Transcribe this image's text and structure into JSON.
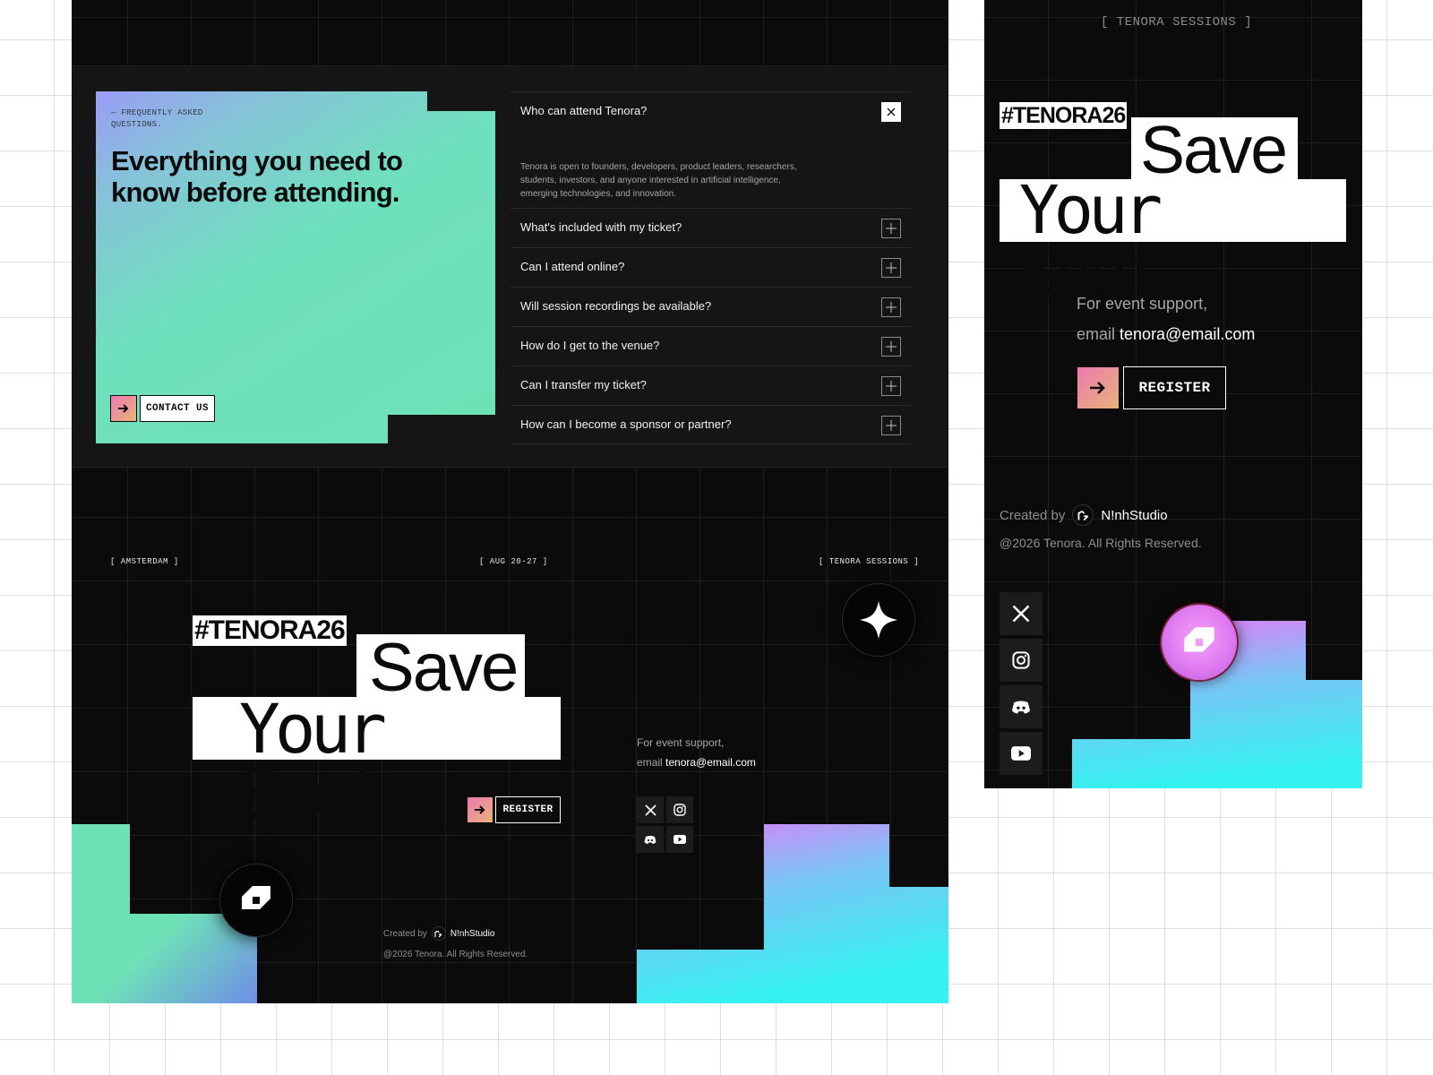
{
  "faq": {
    "kicker": "— FREQUENTLY ASKED QUESTIONS.",
    "title": "Everything you need to know before attending.",
    "contact_label": "CONTACT US",
    "items": [
      {
        "question": "Who can attend Tenora?",
        "answer": "Tenora is open to founders, developers, product leaders, researchers, students, investors, and anyone interested in artificial intelligence, emerging technologies, and innovation.",
        "open": true
      },
      {
        "question": "What's included with my ticket?",
        "open": false
      },
      {
        "question": "Can I attend online?",
        "open": false
      },
      {
        "question": "Will session recordings be available?",
        "open": false
      },
      {
        "question": "How do I get to the venue?",
        "open": false
      },
      {
        "question": "Can I transfer my ticket?",
        "open": false
      },
      {
        "question": "How can I become a sponsor or partner?",
        "open": false
      }
    ]
  },
  "hero": {
    "tag_location": "[ AMSTERDAM ]",
    "tag_dates": "[ AUG 20-27 ]",
    "tag_sessions": "[ TENORA SESSIONS ]",
    "hashtag": "#TENORA26",
    "headline_line1": "Save",
    "headline_line2": "Your Spot.",
    "register_label": "REGISTER",
    "support_line1": "For event support,",
    "support_prefix": "email",
    "support_email": "tenora@email.com"
  },
  "footer": {
    "created_by": "Created by",
    "studio": "N!nhStudio",
    "copyright": "@2026 Tenora. All Rights Reserved.",
    "social": [
      "x-icon",
      "instagram-icon",
      "discord-icon",
      "youtube-icon"
    ]
  },
  "mobile": {
    "tag_sessions": "[ TENORA SESSIONS ]",
    "hashtag": "#TENORA26",
    "headline_line1": "Save",
    "headline_line2": "Your Spot.",
    "support_line1": "For event support,",
    "support_prefix": "email",
    "support_email": "tenora@email.com",
    "register_label": "REGISTER",
    "created_by": "Created by",
    "studio": "N!nhStudio",
    "copyright": "@2026 Tenora. All Rights Reserved."
  },
  "colors": {
    "background": "#0b0b0c",
    "accent_pink": "#ee79b0",
    "accent_mint": "#6ee2b6",
    "accent_cyan": "#33f2f0",
    "accent_violet": "#e47af8"
  }
}
